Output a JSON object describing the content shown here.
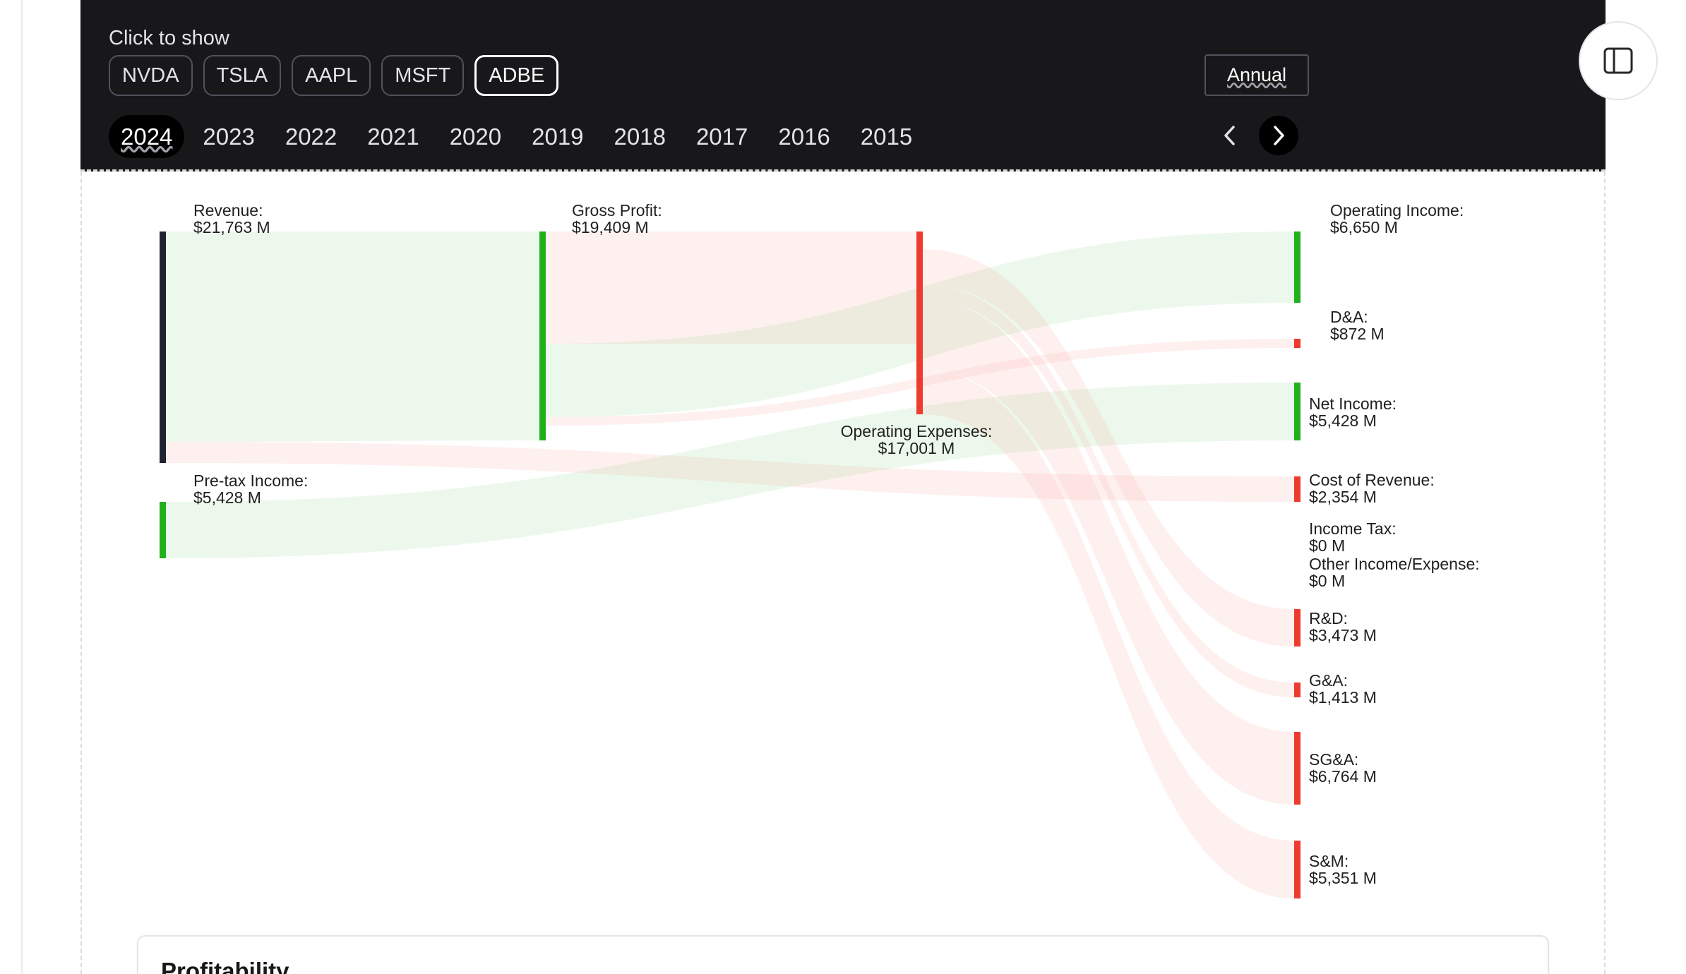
{
  "header": {
    "click_to_show": "Click to show",
    "tickers": [
      "NVDA",
      "TSLA",
      "AAPL",
      "MSFT",
      "ADBE"
    ],
    "active_ticker": "ADBE",
    "period_label": "Annual",
    "years": [
      "2024",
      "2023",
      "2022",
      "2021",
      "2020",
      "2019",
      "2018",
      "2017",
      "2016",
      "2015"
    ],
    "active_year": "2024"
  },
  "icons": {
    "prev": "chevron-left-icon",
    "next": "chevron-right-icon",
    "sidebar": "sidebar-panel-icon"
  },
  "colors": {
    "panel_bg": "#18181b",
    "profit_green": "#22b01c",
    "expense_red": "#ee3b2f",
    "revenue_dark": "#1f2430"
  },
  "chart_data": {
    "type": "sankey",
    "unit": "$ M",
    "nodes": [
      {
        "id": "revenue",
        "label": "Revenue:",
        "value_text": "$21,763 M",
        "value": 21763,
        "kind": "revenue"
      },
      {
        "id": "pretax",
        "label": "Pre-tax Income:",
        "value_text": "$5,428 M",
        "value": 5428,
        "kind": "profit"
      },
      {
        "id": "gross",
        "label": "Gross Profit:",
        "value_text": "$19,409 M",
        "value": 19409,
        "kind": "profit"
      },
      {
        "id": "opex",
        "label": "Operating Expenses:",
        "value_text": "$17,001 M",
        "value": 17001,
        "kind": "expense"
      },
      {
        "id": "opinc",
        "label": "Operating Income:",
        "value_text": "$6,650 M",
        "value": 6650,
        "kind": "profit"
      },
      {
        "id": "da",
        "label": "D&A:",
        "value_text": "$872 M",
        "value": 872,
        "kind": "expense"
      },
      {
        "id": "netinc",
        "label": "Net Income:",
        "value_text": "$5,428 M",
        "value": 5428,
        "kind": "profit"
      },
      {
        "id": "cor",
        "label": "Cost of Revenue:",
        "value_text": "$2,354 M",
        "value": 2354,
        "kind": "expense"
      },
      {
        "id": "tax",
        "label": "Income Tax:",
        "value_text": "$0 M",
        "value": 0,
        "kind": "expense"
      },
      {
        "id": "other",
        "label": "Other Income/Expense:",
        "value_text": "$0 M",
        "value": 0,
        "kind": "expense"
      },
      {
        "id": "rd",
        "label": "R&D:",
        "value_text": "$3,473 M",
        "value": 3473,
        "kind": "expense"
      },
      {
        "id": "ga",
        "label": "G&A:",
        "value_text": "$1,413 M",
        "value": 1413,
        "kind": "expense"
      },
      {
        "id": "sga",
        "label": "SG&A:",
        "value_text": "$6,764 M",
        "value": 6764,
        "kind": "expense"
      },
      {
        "id": "sm",
        "label": "S&M:",
        "value_text": "$5,351 M",
        "value": 5351,
        "kind": "expense"
      }
    ],
    "links": [
      {
        "source": "revenue",
        "target": "gross",
        "kind": "profit"
      },
      {
        "source": "revenue",
        "target": "cor",
        "kind": "expense"
      },
      {
        "source": "gross",
        "target": "opex",
        "kind": "expense"
      },
      {
        "source": "gross",
        "target": "opinc",
        "kind": "profit"
      },
      {
        "source": "gross",
        "target": "da",
        "kind": "expense"
      },
      {
        "source": "pretax",
        "target": "netinc",
        "kind": "profit"
      },
      {
        "source": "opex",
        "target": "rd",
        "kind": "expense"
      },
      {
        "source": "opex",
        "target": "ga",
        "kind": "expense"
      },
      {
        "source": "opex",
        "target": "sga",
        "kind": "expense"
      },
      {
        "source": "opex",
        "target": "sm",
        "kind": "expense"
      }
    ]
  },
  "card": {
    "title": "Profitability"
  }
}
